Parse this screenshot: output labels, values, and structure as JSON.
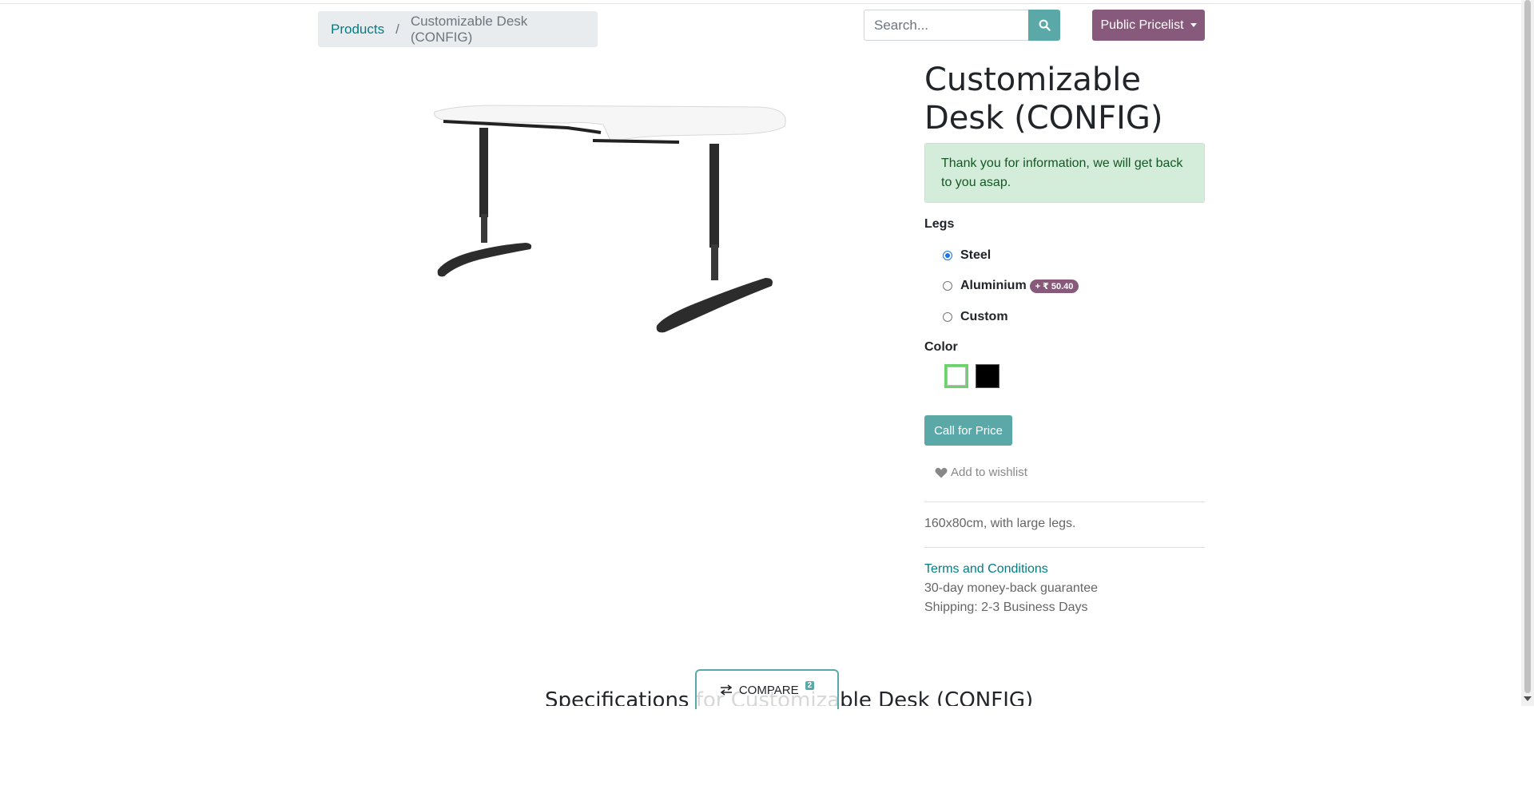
{
  "breadcrumb": {
    "root": "Products",
    "current": "Customizable Desk (CONFIG)"
  },
  "search": {
    "placeholder": "Search..."
  },
  "pricelist": {
    "label": "Public Pricelist"
  },
  "product": {
    "title": "Customizable Desk (CONFIG)",
    "alert": "Thank you for information, we will get back to you asap.",
    "legs": {
      "label": "Legs",
      "options": [
        {
          "label": "Steel",
          "selected": true
        },
        {
          "label": "Aluminium",
          "price_badge": "+ ₹ 50.40",
          "selected": false
        },
        {
          "label": "Custom",
          "selected": false
        }
      ]
    },
    "color": {
      "label": "Color",
      "options": [
        "#ffffff",
        "#000000"
      ],
      "selected": "#ffffff"
    },
    "cta": "Call for Price",
    "wishlist": "Add to wishlist",
    "description": "160x80cm, with large legs.",
    "terms_link": "Terms and Conditions",
    "guarantee": "30-day money-back guarantee",
    "shipping": "Shipping: 2-3 Business Days"
  },
  "compare": {
    "label": "COMPARE",
    "count": "2"
  },
  "specs": {
    "title": "Specifications for Customizable Desk (CONFIG)"
  },
  "colors": {
    "accent": "#5aa9a8",
    "brand": "#875a7b",
    "link": "#017e84",
    "alert_bg": "#d4edda"
  }
}
